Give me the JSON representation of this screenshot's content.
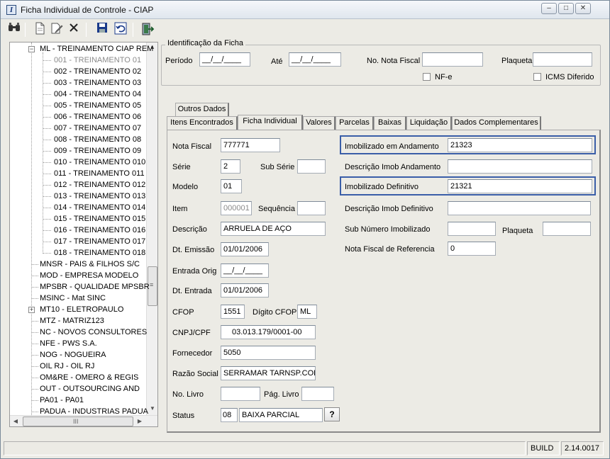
{
  "window": {
    "title": "Ficha Individual de Controle - CIAP",
    "app_icon": "I",
    "controls": [
      "minimize-icon",
      "maximize-icon",
      "close-icon"
    ]
  },
  "toolbar": {
    "icons": [
      "binoculars-icon",
      "new-document-icon",
      "edit-document-icon",
      "delete-icon",
      "save-icon",
      "undo-icon",
      "exit-icon"
    ]
  },
  "tree": {
    "root_label": "ML - TREINAMENTO CIAP REM",
    "children": [
      "001 - TREINAMENTO 01",
      "002 - TREINAMENTO 02",
      "003 - TREINAMENTO 03",
      "004 - TREINAMENTO 04",
      "005 - TREINAMENTO 05",
      "006 - TREINAMENTO 06",
      "007 - TREINAMENTO 07",
      "008 - TREINAMENTO 08",
      "009 - TREINAMENTO 09",
      "010 - TREINAMENTO 010",
      "011 - TREINAMENTO 011",
      "012 - TREINAMENTO 012",
      "013 - TREINAMENTO 013",
      "014 - TREINAMENTO 014",
      "015 - TREINAMENTO 015",
      "016 - TREINAMENTO 016",
      "017 - TREINAMENTO 017",
      "018 - TREINAMENTO 018"
    ],
    "companies": [
      "MNSR - PAIS & FILHOS S/C",
      "MOD - EMPRESA MODELO",
      "MPSBR - QUALIDADE MPSBR",
      "MSINC - Mat SINC",
      "MT10 - ELETROPAULO",
      "MTZ - MATRIZ123",
      "NC - NOVOS CONSULTORES",
      "NFE - PWS S.A.",
      "NOG - NOGUEIRA",
      "OIL RJ - OIL RJ",
      "OM&RE - OMERO & REGIS",
      "OUT - OUTSOURCING AND",
      "PA01 - PA01",
      "PADUA - INDUSTRIAS PADUA"
    ],
    "scroll_grip": "≡",
    "hscroll_grip": "III"
  },
  "identificacao": {
    "title": "Identificação da Ficha",
    "periodo_label": "Período",
    "periodo_value": "__/__/____",
    "ate_label": "Até",
    "ate_value": "__/__/____",
    "nota_fiscal_label": "No. Nota Fiscal",
    "nota_fiscal_value": "",
    "plaqueta_label": "Plaqueta",
    "plaqueta_value": "",
    "nfe_label": "NF-e",
    "icms_label": "ICMS Diferido"
  },
  "tabs": {
    "row1": [
      "Outros Dados"
    ],
    "row2": [
      "Itens Encontrados",
      "Ficha Individual",
      "Valores",
      "Parcelas",
      "Baixas",
      "Liquidação",
      "Dados Complementares"
    ],
    "active": "Ficha Individual"
  },
  "form": {
    "nota_fiscal": {
      "label": "Nota Fiscal",
      "value": "777771"
    },
    "serie": {
      "label": "Série",
      "value": "2"
    },
    "sub_serie": {
      "label": "Sub Série",
      "value": ""
    },
    "modelo": {
      "label": "Modelo",
      "value": "01"
    },
    "item": {
      "label": "Item",
      "value": "000001"
    },
    "sequencia": {
      "label": "Sequência",
      "value": ""
    },
    "descricao": {
      "label": "Descrição",
      "value": "ARRUELA DE AÇO"
    },
    "dt_emissao": {
      "label": "Dt. Emissão",
      "value": "01/01/2006"
    },
    "entrada_orig": {
      "label": "Entrada Orig",
      "value": "__/__/____"
    },
    "dt_entrada": {
      "label": "Dt. Entrada",
      "value": "01/01/2006"
    },
    "cfop": {
      "label": "CFOP",
      "value": "1551"
    },
    "digito_cfop": {
      "label": "Dígito CFOP",
      "value": "ML"
    },
    "cnpj": {
      "label": "CNPJ/CPF",
      "value": "03.013.179/0001-00"
    },
    "fornecedor": {
      "label": "Fornecedor",
      "value": "5050"
    },
    "razao_social": {
      "label": "Razão Social",
      "value": "SERRAMAR TARNSP.COLE"
    },
    "no_livro": {
      "label": "No. Livro",
      "value": ""
    },
    "pag_livro": {
      "label": "Pág. Livro",
      "value": ""
    },
    "status": {
      "label": "Status",
      "code": "08",
      "value": "BAIXA PARCIAL",
      "button": "?"
    },
    "imob_andamento": {
      "label": "Imobilizado em Andamento",
      "value": "21323"
    },
    "desc_imob_andamento": {
      "label": "Descrição Imob Andamento",
      "value": ""
    },
    "imob_definitivo": {
      "label": "Imobilizado Definitivo",
      "value": "21321"
    },
    "desc_imob_definitivo": {
      "label": "Descrição Imob Definitivo",
      "value": ""
    },
    "sub_numero": {
      "label": "Sub Número Imobilizado",
      "value": ""
    },
    "plaqueta": {
      "label": "Plaqueta",
      "value": ""
    },
    "nf_referencia": {
      "label": "Nota Fiscal de Referencia",
      "value": "0"
    }
  },
  "statusbar": {
    "mode": "BUILD",
    "version": "2.14.0017"
  },
  "colors": {
    "highlight_border": "#3a5ea8",
    "window_bg": "#ecebe5"
  }
}
